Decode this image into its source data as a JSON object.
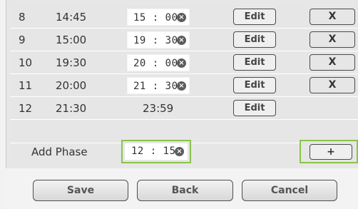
{
  "phases": [
    {
      "number": "8",
      "start": "14:45",
      "end_input": "15 : 00",
      "edit_label": "Edit",
      "delete_label": "X"
    },
    {
      "number": "9",
      "start": "15:00",
      "end_input": "19 : 30",
      "edit_label": "Edit",
      "delete_label": "X"
    },
    {
      "number": "10",
      "start": "19:30",
      "end_input": "20 : 00",
      "edit_label": "Edit",
      "delete_label": "X"
    },
    {
      "number": "11",
      "start": "20:00",
      "end_input": "21 : 30",
      "edit_label": "Edit",
      "delete_label": "X"
    },
    {
      "number": "12",
      "start": "21:30",
      "end_static": "23:59",
      "edit_label": "Edit"
    }
  ],
  "clear_symbol": "×",
  "add_phase": {
    "label": "Add Phase",
    "time_input": "12 : 15",
    "add_button_label": "+"
  },
  "footer": {
    "save_label": "Save",
    "back_label": "Back",
    "cancel_label": "Cancel"
  },
  "colors": {
    "highlight_border": "#8bc34a",
    "panel_background": "#e6e6e6"
  }
}
